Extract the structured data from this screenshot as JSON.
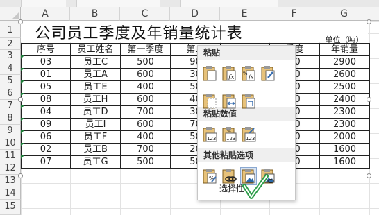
{
  "column_headers": [
    "A",
    "B",
    "C",
    "D",
    "E",
    "F",
    "G"
  ],
  "row_headers": [
    "1",
    "2",
    "3",
    "4",
    "5",
    "6",
    "7",
    "8",
    "9",
    "10",
    "11",
    "12",
    "13",
    "14",
    "15"
  ],
  "sheet": {
    "title": "公司员工季度及年销量统计表",
    "unit_label": "单位（吨）",
    "table_header": [
      "序号",
      "员工姓名",
      "第一季度",
      "第二",
      "",
      "季度",
      "年销量"
    ],
    "rows": [
      [
        "03",
        "员工C",
        "500",
        "90",
        "",
        "00",
        "2900"
      ],
      [
        "01",
        "员工A",
        "600",
        "30",
        "",
        "00",
        "2600"
      ],
      [
        "05",
        "员工E",
        "400",
        "50",
        "",
        "00",
        "2500"
      ],
      [
        "08",
        "员工H",
        "600",
        "40",
        "",
        "00",
        "2400"
      ],
      [
        "04",
        "员工D",
        "700",
        "30",
        "",
        "00",
        "2300"
      ],
      [
        "09",
        "员工I",
        "600",
        "70",
        "",
        "00",
        "2300"
      ],
      [
        "06",
        "员工F",
        "400",
        "50",
        "",
        "00",
        "2000"
      ],
      [
        "02",
        "员工B",
        "700",
        "20",
        "",
        "00",
        "1600"
      ],
      [
        "07",
        "员工G",
        "500",
        "50",
        "",
        "00",
        "1600"
      ]
    ]
  },
  "paste_menu": {
    "section_paste": "粘贴",
    "section_paste_values": "粘贴数值",
    "section_other": "其他粘贴选项",
    "paste_icons": [
      "paste-icon",
      "paste-formulas-icon",
      "paste-formulas-number-format-icon",
      "keep-source-formatting-icon",
      "no-borders-icon",
      "keep-column-widths-icon",
      "transpose-icon"
    ],
    "values_icons": [
      "paste-values-icon",
      "values-number-format-icon",
      "values-source-formatting-icon"
    ],
    "other_icons": [
      "paste-formatting-icon",
      "paste-link-icon",
      "paste-picture-icon",
      "linked-picture-icon"
    ],
    "selected_icon": "paste-picture-icon",
    "paste_special_label": "选择性粘贴...",
    "paste_special_visible": "选择性"
  },
  "colors": {
    "selection_outline": "#8aa8d0",
    "selection_fill": "#d6e2f2",
    "error_indicator": "#1e7d3a",
    "cursor": "#2e9e4a"
  }
}
